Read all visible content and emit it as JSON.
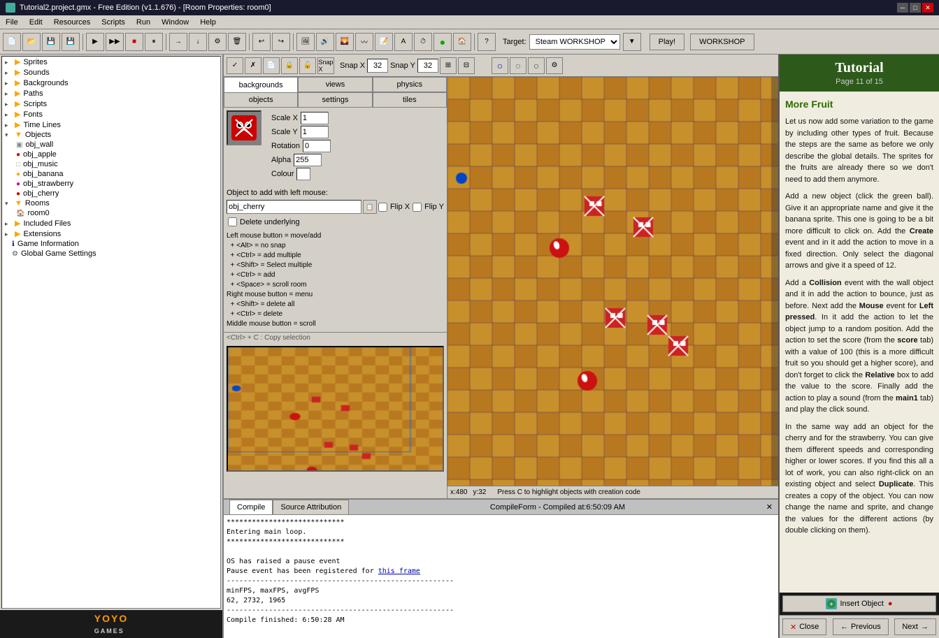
{
  "titlebar": {
    "title": "Tutorial2.project.gmx  -  Free Edition (v1.1.676) - [Room Properties: room0]",
    "icon": "gm-icon"
  },
  "menubar": {
    "items": [
      "File",
      "Edit",
      "Resources",
      "Scripts",
      "Run",
      "Window",
      "Help"
    ]
  },
  "toolbar": {
    "target_label": "Target:",
    "target_value": "Steam WORKSHOP",
    "play_label": "Play!",
    "workshop_label": "WORKSHOP"
  },
  "room_tabs": {
    "tab1": "backgrounds",
    "tab2": "views",
    "tab3": "physics",
    "tab4": "objects",
    "tab5": "settings",
    "tab6": "tiles"
  },
  "room_toolbar": {
    "snap_x_label": "Snap X",
    "snap_x_value": "32",
    "snap_y_label": "Snap Y",
    "snap_y_value": "32"
  },
  "object_panel": {
    "scale_x_label": "Scale X",
    "scale_x_value": "1",
    "scale_y_label": "Scale Y",
    "scale_y_value": "1",
    "rotation_label": "Rotation",
    "rotation_value": "0",
    "alpha_label": "Alpha",
    "alpha_value": "255",
    "colour_label": "Colour",
    "obj_label": "Object to add with left mouse:",
    "obj_name": "obj_cherry",
    "flip_x_label": "Flip X",
    "flip_y_label": "Flip Y",
    "delete_label": "Delete underlying",
    "instructions": [
      "Left mouse button = move/add",
      "  + <Alt> = no snap",
      "  + <Ctrl> = add multiple",
      "  + <Shift> = Select multiple",
      "  + <Ctrl> = add",
      "  + <Space> = scroll room",
      "Right mouse button = menu",
      "  + <Shift> = delete all",
      "  + <Ctrl> = delete",
      "Middle mouse button = scroll"
    ],
    "bottom_hint": "<Ctrl> + C : Copy selection"
  },
  "resource_tree": {
    "sprites": "Sprites",
    "sounds": "Sounds",
    "backgrounds": "Backgrounds",
    "paths": "Paths",
    "scripts": "Scripts",
    "fonts": "Fonts",
    "timelines": "Time Lines",
    "objects": "Objects",
    "obj_items": [
      "obj_wall",
      "obj_apple",
      "obj_music",
      "obj_banana",
      "obj_strawberry",
      "obj_cherry"
    ],
    "rooms": "Rooms",
    "room_items": [
      "room0"
    ],
    "included_files": "Included Files",
    "extensions": "Extensions",
    "game_information": "Game Information",
    "global_game_settings": "Global Game Settings"
  },
  "status_bar": {
    "x_label": "x:",
    "x_value": "480",
    "y_label": "y:",
    "y_value": "32",
    "hint": "Press C to highlight objects with creation code"
  },
  "tutorial": {
    "title": "Tutorial",
    "page": "Page 11 of 15",
    "section": "More Fruit",
    "content": [
      "Let us now add some variation to the game by including other types of fruit. Because the steps are the same as before we only describe the global details. The sprites for the fruits are already there so we don't need to add them anymore.",
      "Add a new object (click the green ball). Give it an appropriate name and give it the banana sprite. This one is going to be a bit more difficult to click on. Add the Create event and in it add the action to move in a fixed direction. Only select the diagonal arrows and give it a speed of 12.",
      "Add a Collision event with the wall object and it in add the action to bounce, just as before. Next add the Mouse event for Left pressed. In it add the action to let the object jump to a random position. Add the action to set the score (from the score tab) with a value of 100 (this is a more difficult fruit so you should get a higher score), and don't forget to click the Relative box to add the value to the score. Finally add the action to play a sound (from the main1 tab) and play the click sound.",
      "In the same way add an object for the cherry and for the strawberry. You can give them different speeds and corresponding higher or lower scores. If you find this all a lot of work, you can also right-click on an existing object and select Duplicate. This creates a copy of the object. You can now change the name and sprite, and change the values for the different actions (by double clicking on them)."
    ],
    "insert_btn": "Insert Object",
    "prev_btn": "Previous",
    "next_btn": "Next"
  },
  "compile": {
    "title": "CompileForm - Compiled at:6:50:09 AM",
    "tab1": "Compile",
    "tab2": "Source Attribution",
    "output": [
      "****************************",
      "Entering main loop.",
      "****************************",
      "",
      "OS has raised a pause event",
      "Pause event has been registered for this frame",
      "------------------------------------------------------",
      "minFPS, maxFPS, avgFPS",
      "62, 2732, 1965",
      "------------------------------------------------------",
      "Compile finished: 6:50:28 AM"
    ]
  },
  "yoyo_logo": "YOYO GAMES"
}
